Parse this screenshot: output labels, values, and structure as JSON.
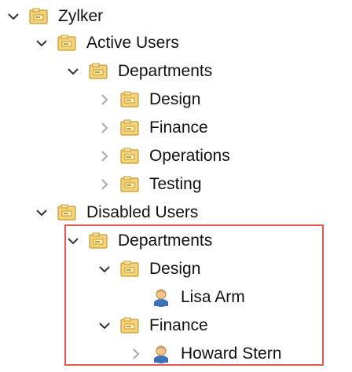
{
  "tree": {
    "nodes": [
      {
        "label": "Zylker",
        "expanded": true,
        "chevron": "chevron-down-icon",
        "icon": "folder-icon"
      },
      {
        "label": "Active Users",
        "expanded": true,
        "chevron": "chevron-down-icon",
        "icon": "folder-icon"
      },
      {
        "label": "Departments",
        "expanded": true,
        "chevron": "chevron-down-icon",
        "icon": "folder-icon"
      },
      {
        "label": "Design",
        "expanded": false,
        "chevron": "chevron-right-icon",
        "icon": "folder-icon"
      },
      {
        "label": "Finance",
        "expanded": false,
        "chevron": "chevron-right-icon",
        "icon": "folder-icon"
      },
      {
        "label": "Operations",
        "expanded": false,
        "chevron": "chevron-right-icon",
        "icon": "folder-icon"
      },
      {
        "label": "Testing",
        "expanded": false,
        "chevron": "chevron-right-icon",
        "icon": "folder-icon"
      },
      {
        "label": "Disabled Users",
        "expanded": true,
        "chevron": "chevron-down-icon",
        "icon": "folder-icon"
      },
      {
        "label": "Departments",
        "expanded": true,
        "chevron": "chevron-down-icon",
        "icon": "folder-icon"
      },
      {
        "label": "Design",
        "expanded": true,
        "chevron": "chevron-down-icon",
        "icon": "folder-icon"
      },
      {
        "label": "Lisa Arm",
        "expanded": false,
        "chevron": "none",
        "icon": "user-icon"
      },
      {
        "label": "Finance",
        "expanded": true,
        "chevron": "chevron-down-icon",
        "icon": "folder-icon"
      },
      {
        "label": "Howard Stern",
        "expanded": false,
        "chevron": "chevron-right-icon",
        "icon": "user-icon"
      }
    ]
  },
  "colors": {
    "highlight_border": "#e05a52",
    "folder_fill": "#f2d27a",
    "folder_edge": "#c79b2e",
    "chevron": "#333333",
    "chevron_muted": "#a8a8a8"
  }
}
